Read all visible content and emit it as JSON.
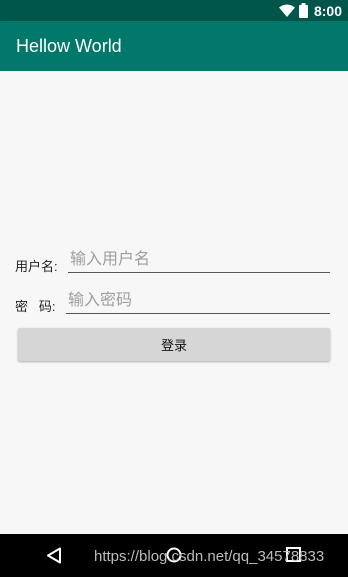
{
  "status_bar": {
    "time": "8:00",
    "icons": [
      "wifi-icon",
      "battery-icon"
    ]
  },
  "app_bar": {
    "title": "Hellow World",
    "color": "#00796b",
    "status_color": "#00564b"
  },
  "form": {
    "username": {
      "label": "用户名:",
      "placeholder": "输入用户名",
      "value": ""
    },
    "password": {
      "label": "密   码:",
      "placeholder": "输入密码",
      "value": ""
    },
    "login_label": "登录"
  },
  "nav_bar": {
    "icons": [
      "back-icon",
      "home-icon",
      "recents-icon"
    ],
    "watermark": "https://blog.csdn.net/qq_34578833"
  }
}
